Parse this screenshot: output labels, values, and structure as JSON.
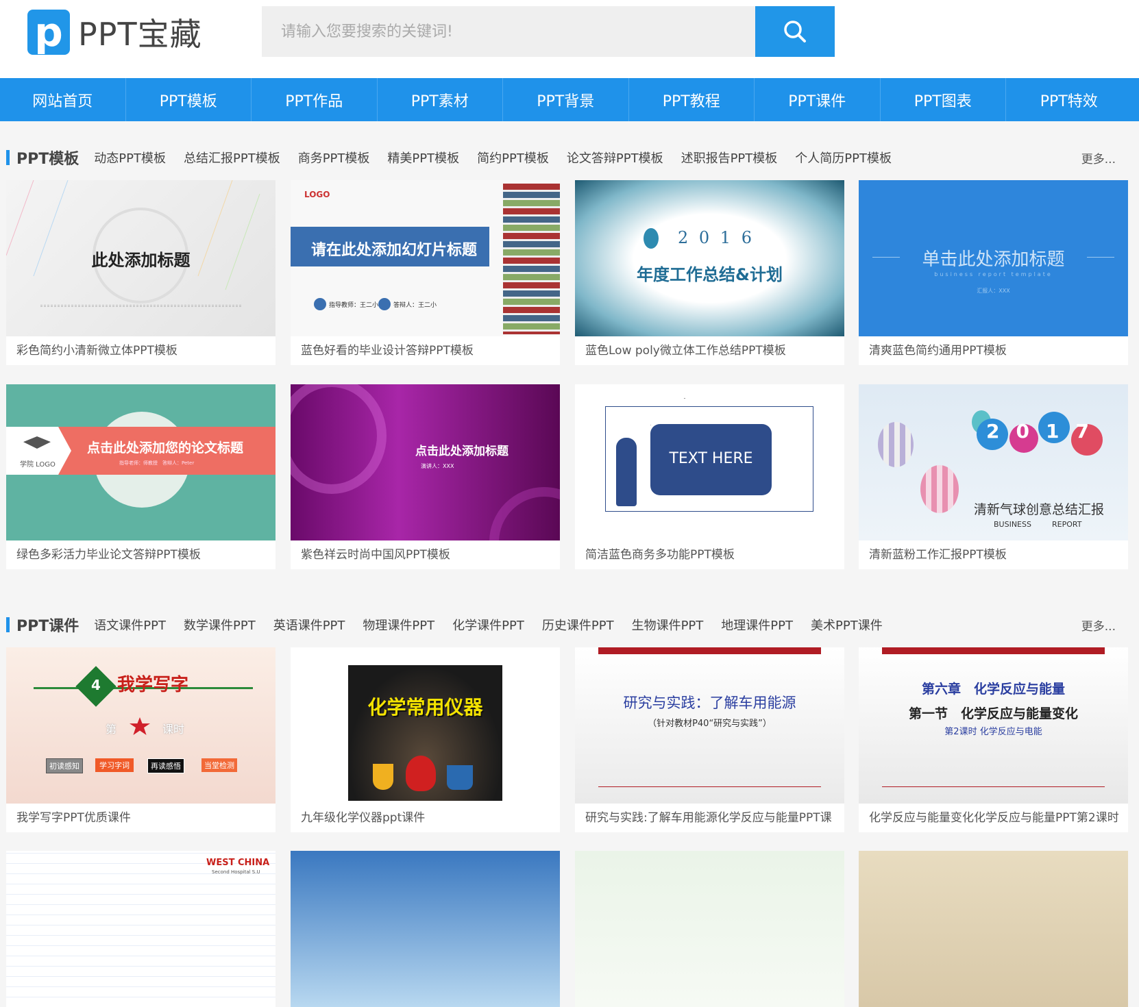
{
  "header": {
    "logo_letter": "p",
    "logo_text": "PPT宝藏",
    "search_placeholder": "请输入您要搜索的关键词!"
  },
  "nav": [
    "网站首页",
    "PPT模板",
    "PPT作品",
    "PPT素材",
    "PPT背景",
    "PPT教程",
    "PPT课件",
    "PPT图表",
    "PPT特效"
  ],
  "sections": [
    {
      "title": "PPT模板",
      "links": [
        "动态PPT模板",
        "总结汇报PPT模板",
        "商务PPT模板",
        "精美PPT模板",
        "简约PPT模板",
        "论文答辩PPT模板",
        "述职报告PPT模板",
        "个人简历PPT模板"
      ],
      "more": "更多..."
    },
    {
      "title": "PPT课件",
      "links": [
        "语文课件PPT",
        "数学课件PPT",
        "英语课件PPT",
        "物理课件PPT",
        "化学课件PPT",
        "历史课件PPT",
        "生物课件PPT",
        "地理课件PPT",
        "美术PPT课件"
      ],
      "more": "更多..."
    }
  ],
  "cards": [
    {
      "title": "彩色简约小清新微立体PPT模板",
      "thumb_text": "此处添加标题"
    },
    {
      "title": "蓝色好看的毕业设计答辩PPT模板",
      "thumb_text": "请在此处添加幻灯片标题",
      "thumb_logo": "LOGO",
      "thumb_sub1": "指导教师：王二小",
      "thumb_sub2": "答辩人：王二小"
    },
    {
      "title": "蓝色Low poly微立体工作总结PPT模板",
      "thumb_year": "2 0 1 6",
      "thumb_text": "年度工作总结&计划"
    },
    {
      "title": "清爽蓝色简约通用PPT模板",
      "thumb_text": "单击此处添加标题",
      "thumb_sub1": "business report template",
      "thumb_sub2": "汇报人：XXX"
    },
    {
      "title": "绿色多彩活力毕业论文答辩PPT模板",
      "thumb_text": "点击此处添加您的论文标题",
      "thumb_logo": "学院 LOGO",
      "thumb_sub1": "指导老师：师教授　答辩人：Peter"
    },
    {
      "title": "紫色祥云时尚中国风PPT模板",
      "thumb_text": "点击此处添加标题",
      "thumb_sub1": "演讲人：XXX"
    },
    {
      "title": "简洁蓝色商务多功能PPT模板",
      "thumb_text": "TEXT HERE"
    },
    {
      "title": "清新蓝粉工作汇报PPT模板",
      "thumb_year": "2017",
      "thumb_text": "清新气球创意总结汇报",
      "thumb_sub1": "BUSINESS",
      "thumb_sub2": "REPORT"
    },
    {
      "title": "我学写字PPT优质课件",
      "thumb_text": "我学写字",
      "thumb_num": "4",
      "thumb_sub1": "第",
      "thumb_sub2": "课时",
      "thumb_steps": [
        "初读感知",
        "学习字词",
        "再读感悟",
        "当堂检测"
      ]
    },
    {
      "title": "九年级化学仪器ppt课件",
      "thumb_text": "化学常用仪器"
    },
    {
      "title": "研究与实践:了解车用能源化学反应与能量PPT课",
      "thumb_text": "研究与实践：了解车用能源",
      "thumb_sub1": "（针对教材P40“研究与实践”）"
    },
    {
      "title": "化学反应与能量变化化学反应与能量PPT第2课时",
      "thumb_text": "第六章　化学反应与能量",
      "thumb_sub1": "第一节　化学反应与能量变化",
      "thumb_sub2": "第2课时 化学反应与电能"
    },
    {
      "title": "",
      "thumb_text": "WEST CHINA",
      "thumb_sub1": "Second Hospital S.U"
    },
    {
      "title": ""
    },
    {
      "title": ""
    },
    {
      "title": ""
    }
  ],
  "colors": {
    "accent": "#1f92ea",
    "nav_bg": "#1f92ea",
    "page_bg": "#f5f5f5"
  }
}
